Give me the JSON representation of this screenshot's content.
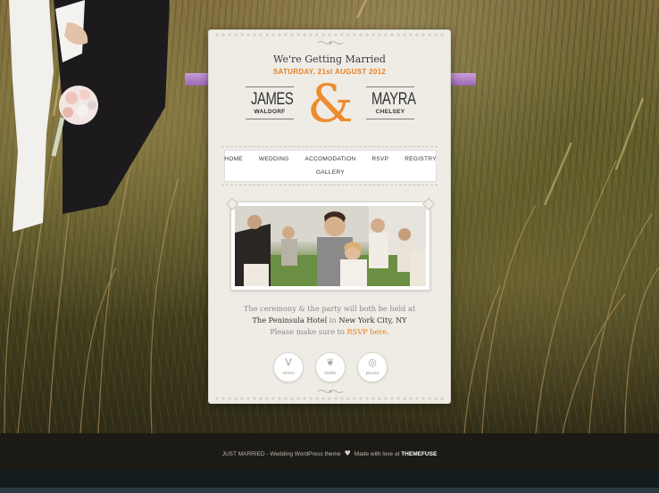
{
  "card": {
    "tagline": "We're Getting Married",
    "date": "SATURDAY, 21st AUGUST 2012",
    "groom": {
      "first": "JAMES",
      "last": "WALDORF"
    },
    "bride": {
      "first": "MAYRA",
      "last": "CHELSEY"
    },
    "ampersand": "&"
  },
  "nav": {
    "items": [
      "HOME",
      "WEDDING",
      "ACCOMODATION",
      "RSVP",
      "REGISTRY",
      "GALLERY"
    ]
  },
  "info": {
    "line1": "The ceremony & the party will both be held at",
    "venue": "The Peninsula Hotel",
    "in": " in ",
    "city": "New York City, NY",
    "rsvp_prefix": "Please make sure to ",
    "rsvp_link": "RSVP here."
  },
  "social": [
    {
      "icon": "vimeo-icon",
      "glyph": "V",
      "label": "vimeo"
    },
    {
      "icon": "twitter-icon",
      "glyph": "❦",
      "label": "twitter"
    },
    {
      "icon": "picasa-icon",
      "glyph": "◎",
      "label": "picasa"
    }
  ],
  "footer": {
    "left": "JUST MARRIED - Wedding WordPress theme",
    "heart": "♥",
    "middle": "Made with love at ",
    "brand": "THEMEFUSE"
  },
  "colors": {
    "accent": "#e8801e",
    "ampersand": "#ee8b2c",
    "ribbon": "#b07ec7",
    "footer": "#1b1a15"
  }
}
